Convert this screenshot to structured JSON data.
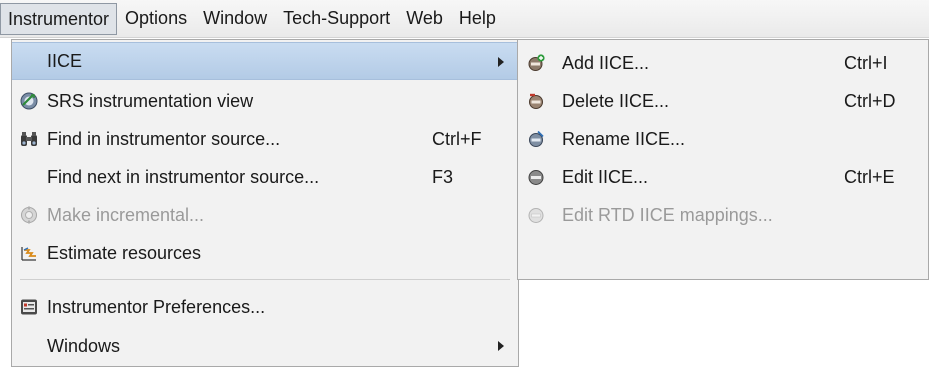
{
  "menubar": {
    "items": [
      {
        "label": "Instrumentor"
      },
      {
        "label": "Options"
      },
      {
        "label": "Window"
      },
      {
        "label": "Tech-Support"
      },
      {
        "label": "Web"
      },
      {
        "label": "Help"
      }
    ],
    "active_index": 0
  },
  "instrumentor_menu": {
    "items": [
      {
        "label": "IICE",
        "accelerator": "",
        "icon": "none",
        "has_submenu": true,
        "selected": true,
        "enabled": true
      },
      {
        "label": "SRS instrumentation view",
        "accelerator": "",
        "icon": "srs-view-icon",
        "enabled": true
      },
      {
        "label": "Find in instrumentor source...",
        "accelerator": "Ctrl+F",
        "icon": "binoculars-icon",
        "enabled": true
      },
      {
        "label": "Find next in instrumentor source...",
        "accelerator": "F3",
        "icon": "none",
        "enabled": true
      },
      {
        "label": "Make incremental...",
        "accelerator": "",
        "icon": "incremental-icon",
        "enabled": false
      },
      {
        "label": "Estimate resources",
        "accelerator": "",
        "icon": "estimate-icon",
        "enabled": true
      },
      {
        "label": "Instrumentor Preferences...",
        "accelerator": "",
        "icon": "preferences-icon",
        "enabled": true
      },
      {
        "label": "Windows",
        "accelerator": "",
        "icon": "none",
        "has_submenu": true,
        "enabled": true
      }
    ]
  },
  "iice_submenu": {
    "items": [
      {
        "label": "Add IICE...",
        "accelerator": "Ctrl+I",
        "icon": "iice-add-icon",
        "enabled": true
      },
      {
        "label": "Delete IICE...",
        "accelerator": "Ctrl+D",
        "icon": "iice-delete-icon",
        "enabled": true
      },
      {
        "label": "Rename IICE...",
        "accelerator": "",
        "icon": "iice-rename-icon",
        "enabled": true
      },
      {
        "label": "Edit IICE...",
        "accelerator": "Ctrl+E",
        "icon": "iice-edit-icon",
        "enabled": true
      },
      {
        "label": "Edit RTD IICE mappings...",
        "accelerator": "",
        "icon": "rtd-mappings-icon",
        "enabled": false
      }
    ]
  },
  "colors": {
    "selection": "#b9d0ea",
    "menu_background": "#f2f2f2",
    "disabled_text": "#9a9a9a"
  }
}
